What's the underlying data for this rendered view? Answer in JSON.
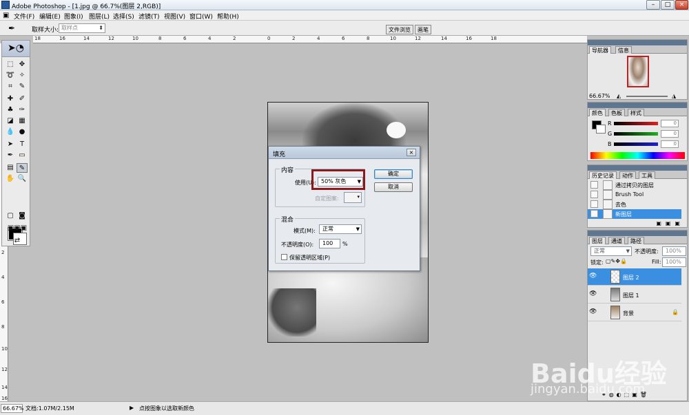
{
  "window": {
    "title": "Adobe Photoshop - [1.jpg @ 66.7%(图层 2,RGB)]",
    "controls": [
      "–",
      "□",
      "×"
    ]
  },
  "menubar": {
    "items": [
      "文件(F)",
      "编辑(E)",
      "图象(I)",
      "图层(L)",
      "选择(S)",
      "滤镜(T)",
      "视图(V)",
      "窗口(W)",
      "帮助(H)"
    ]
  },
  "options": {
    "sample_size_label": "取样大小:",
    "sample_size_value": "取样点"
  },
  "wells": [
    "文件浏览",
    "画笔"
  ],
  "rulers": {
    "horizontal": [
      "18",
      "16",
      "14",
      "12",
      "10",
      "8",
      "6",
      "4",
      "2",
      "0",
      "2",
      "4",
      "6",
      "8",
      "10",
      "12",
      "14",
      "16",
      "18"
    ],
    "vertical": [
      "2",
      "4",
      "6",
      "8",
      "10",
      "12",
      "14",
      "16"
    ]
  },
  "fill_dialog": {
    "title": "填充",
    "content_group": "内容",
    "use_label": "使用(U):",
    "use_value": "50% 灰色",
    "custom_pattern_label": "自定图案:",
    "blend_group": "混合",
    "mode_label": "模式(M):",
    "mode_value": "正常",
    "opacity_label": "不透明度(O):",
    "opacity_value": "100",
    "opacity_unit": "%",
    "preserve_label": "保留透明区域(P)",
    "ok_label": "确定",
    "cancel_label": "取消"
  },
  "navigator": {
    "tabs": [
      "导航器",
      "信息"
    ],
    "zoom": "66.67%"
  },
  "color_panel": {
    "tabs": [
      "颜色",
      "色板",
      "样式"
    ],
    "channels": [
      {
        "label": "R",
        "value": "0",
        "color": "#d82020"
      },
      {
        "label": "G",
        "value": "0",
        "color": "#20b020"
      },
      {
        "label": "B",
        "value": "0",
        "color": "#2020d8"
      }
    ]
  },
  "history_panel": {
    "tabs": [
      "历史记录",
      "动作",
      "工具"
    ],
    "items": [
      {
        "label": "通过拷贝的图层",
        "selected": false
      },
      {
        "label": "Brush Tool",
        "selected": false
      },
      {
        "label": "去色",
        "selected": false
      },
      {
        "label": "新图层",
        "selected": true
      }
    ]
  },
  "layers_panel": {
    "tabs": [
      "图层",
      "通道",
      "路径"
    ],
    "blend_mode": "正常",
    "opacity_label": "不透明度:",
    "opacity_value": "100%",
    "lock_label": "锁定:",
    "fill_label": "Fill:",
    "fill_value": "100%",
    "layers": [
      {
        "name": "图层 2",
        "selected": true
      },
      {
        "name": "图层 1",
        "selected": false
      },
      {
        "name": "背景",
        "selected": false
      }
    ]
  },
  "status": {
    "zoom": "66.67%",
    "doc": "文档:1.07M/2.15M",
    "arrow": "▶",
    "hint": "点按图象以选取新颜色"
  },
  "watermark": {
    "brand": "Baidu经验",
    "url": "jingyan.baidu.com"
  },
  "colors": {
    "accent": "#3b8fe0",
    "highlight_box": "#8b1a1a",
    "canvas_bg": "#c0c0c0"
  }
}
